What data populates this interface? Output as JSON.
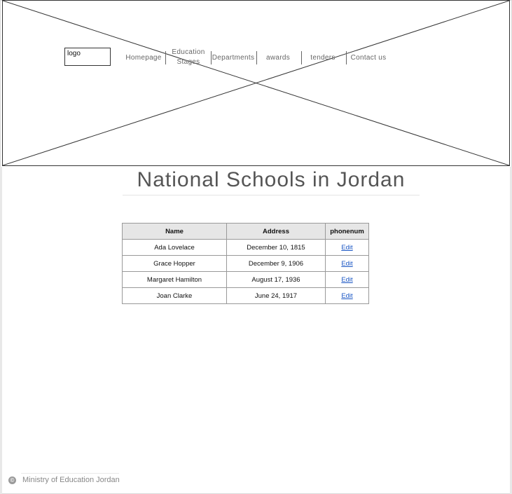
{
  "header": {
    "logo_label": "logo",
    "nav": [
      {
        "label": "Homepage"
      },
      {
        "label": "Education Stages"
      },
      {
        "label": "Departments"
      },
      {
        "label": "awards"
      },
      {
        "label": "tenders"
      },
      {
        "label": "Contact us"
      }
    ]
  },
  "main": {
    "title": "National Schools in Jordan",
    "table": {
      "columns": [
        "Name",
        "Address",
        "phonenum"
      ],
      "rows": [
        {
          "name": "Ada Lovelace",
          "address": "December 10, 1815",
          "action": "Edit"
        },
        {
          "name": "Grace Hopper",
          "address": "December 9, 1906",
          "action": "Edit"
        },
        {
          "name": "Margaret Hamilton",
          "address": "August 17, 1936",
          "action": "Edit"
        },
        {
          "name": "Joan Clarke",
          "address": "June 24, 1917",
          "action": "Edit"
        }
      ]
    }
  },
  "footer": {
    "icon": "copyright-icon",
    "text": "Ministry of Education Jordan"
  }
}
